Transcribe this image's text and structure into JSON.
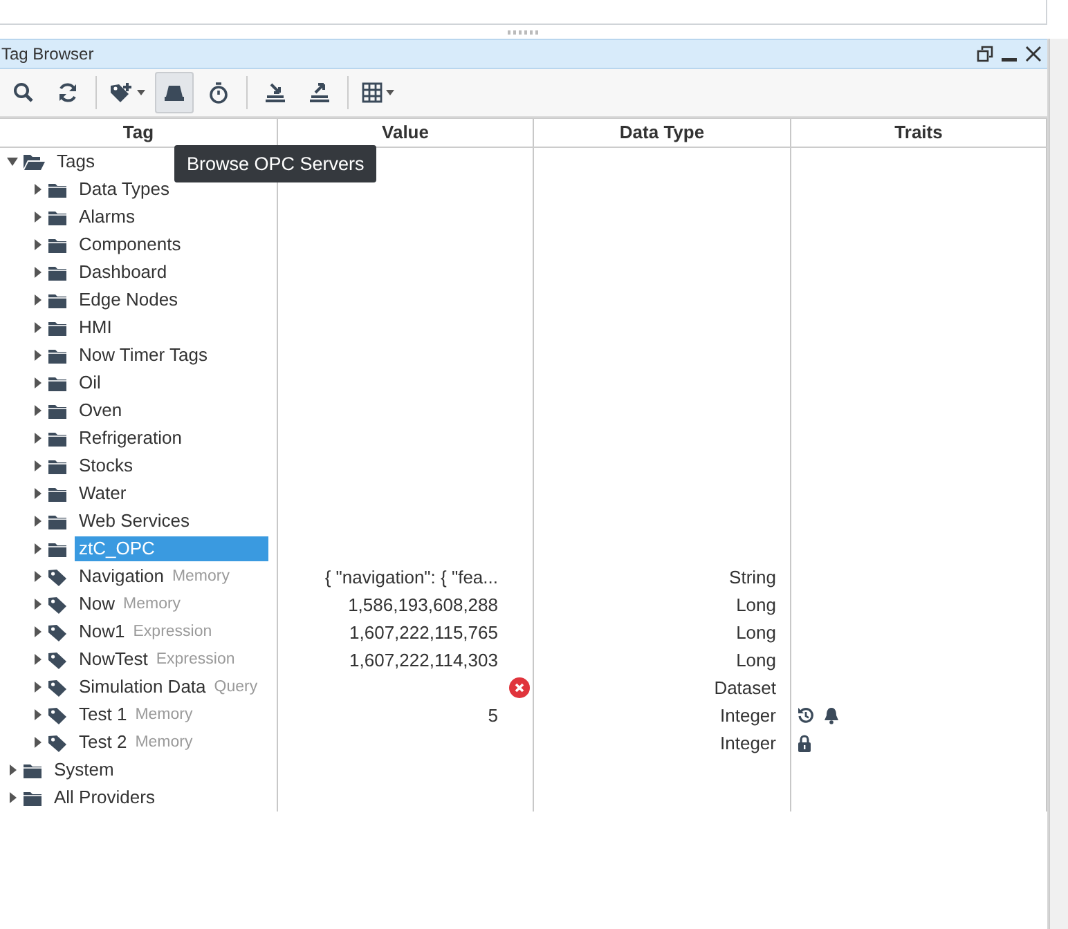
{
  "panel": {
    "title": "Tag Browser"
  },
  "toolbar": [
    {
      "kind": "search",
      "dropdown": false,
      "selected": false
    },
    {
      "kind": "refresh",
      "dropdown": false,
      "selected": false
    },
    {
      "kind": "add-tag",
      "dropdown": true,
      "selected": false
    },
    {
      "kind": "server",
      "dropdown": false,
      "selected": true
    },
    {
      "kind": "timer",
      "dropdown": false,
      "selected": false
    },
    {
      "kind": "import",
      "dropdown": false,
      "selected": false
    },
    {
      "kind": "export",
      "dropdown": false,
      "selected": false
    },
    {
      "kind": "columns",
      "dropdown": true,
      "selected": false
    }
  ],
  "tooltip": "Browse OPC Servers",
  "table": {
    "columns": [
      "Tag",
      "Value",
      "Data Type",
      "Traits"
    ],
    "rows": [
      {
        "kind": "folder",
        "name": "Tags",
        "expanded": true,
        "selected": false,
        "children": [
          {
            "kind": "folder",
            "name": "Data Types",
            "expanded": false,
            "selected": false
          },
          {
            "kind": "folder",
            "name": "Alarms",
            "expanded": false,
            "selected": false
          },
          {
            "kind": "folder",
            "name": "Components",
            "expanded": false,
            "selected": false
          },
          {
            "kind": "folder",
            "name": "Dashboard",
            "expanded": false,
            "selected": false
          },
          {
            "kind": "folder",
            "name": "Edge Nodes",
            "expanded": false,
            "selected": false
          },
          {
            "kind": "folder",
            "name": "HMI",
            "expanded": false,
            "selected": false
          },
          {
            "kind": "folder",
            "name": "Now Timer Tags",
            "expanded": false,
            "selected": false
          },
          {
            "kind": "folder",
            "name": "Oil",
            "expanded": false,
            "selected": false
          },
          {
            "kind": "folder",
            "name": "Oven",
            "expanded": false,
            "selected": false
          },
          {
            "kind": "folder",
            "name": "Refrigeration",
            "expanded": false,
            "selected": false
          },
          {
            "kind": "folder",
            "name": "Stocks",
            "expanded": false,
            "selected": false
          },
          {
            "kind": "folder",
            "name": "Water",
            "expanded": false,
            "selected": false
          },
          {
            "kind": "folder",
            "name": "Web Services",
            "expanded": false,
            "selected": false
          },
          {
            "kind": "folder",
            "name": "ztC_OPC",
            "expanded": false,
            "selected": true
          },
          {
            "kind": "tag",
            "name": "Navigation",
            "tag_type": "Memory",
            "value": "{  \"navigation\": {     \"fea...",
            "data_type": "String",
            "expanded": false,
            "selected": false
          },
          {
            "kind": "tag",
            "name": "Now",
            "tag_type": "Memory",
            "value": "1,586,193,608,288",
            "data_type": "Long",
            "expanded": false,
            "selected": false
          },
          {
            "kind": "tag",
            "name": "Now1",
            "tag_type": "Expression",
            "value": "1,607,222,115,765",
            "data_type": "Long",
            "expanded": false,
            "selected": false
          },
          {
            "kind": "tag",
            "name": "NowTest",
            "tag_type": "Expression",
            "value": "1,607,222,114,303",
            "data_type": "Long",
            "expanded": false,
            "selected": false
          },
          {
            "kind": "tag",
            "name": "Simulation Data",
            "tag_type": "Query",
            "error": true,
            "data_type": "Dataset",
            "expanded": false,
            "selected": false
          },
          {
            "kind": "tag",
            "name": "Test 1",
            "tag_type": "Memory",
            "value": "5",
            "data_type": "Integer",
            "traits": [
              {
                "kind": "history"
              },
              {
                "kind": "alarm"
              }
            ],
            "expanded": false,
            "selected": false
          },
          {
            "kind": "tag",
            "name": "Test 2",
            "tag_type": "Memory",
            "data_type": "Integer",
            "traits": [
              {
                "kind": "locked"
              }
            ],
            "expanded": false,
            "selected": false
          }
        ]
      },
      {
        "kind": "folder",
        "name": "System",
        "expanded": false,
        "selected": false
      },
      {
        "kind": "folder",
        "name": "All Providers",
        "expanded": false,
        "selected": false
      }
    ]
  }
}
